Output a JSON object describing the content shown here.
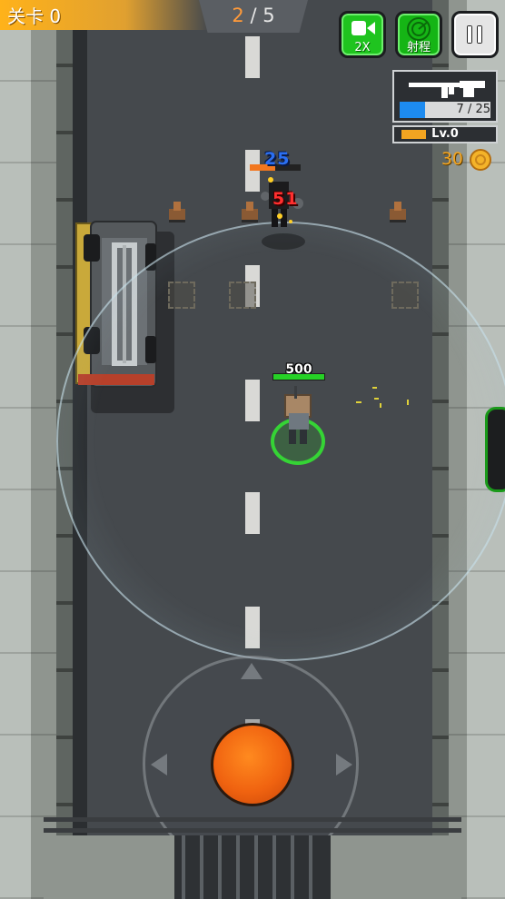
{
  "hud": {
    "level_label": "关卡 0",
    "wave": {
      "current": "2",
      "separator": " / ",
      "total": "5"
    },
    "speed_button_label": "2X",
    "range_button_label": "射程"
  },
  "weapon": {
    "icon": "assault-rifle-icon",
    "ammo_text": "7 / 25",
    "ammo_fraction": 0.28,
    "level_text": "Lv.0",
    "level_fraction": 0.28
  },
  "coins": {
    "count": "30",
    "icon": "coin-icon"
  },
  "combat": {
    "damage_blue": "25",
    "damage_red": "51",
    "enemy_hp_fraction": 0.5,
    "player_hp_label": "500",
    "player_hp_fraction": 1.0
  },
  "colors": {
    "accent_green": "#1fc41f",
    "level_bar_orange": "#ffb21a",
    "ammo_blue": "#1d8bf0",
    "coin_gold": "#f2a421",
    "joystick_orange": "#f06310"
  }
}
